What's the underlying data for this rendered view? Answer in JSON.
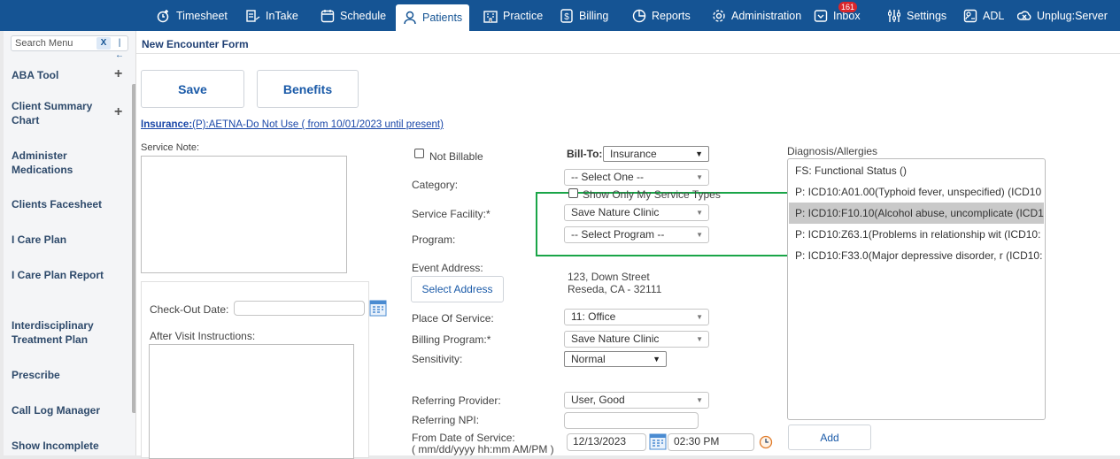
{
  "nav": {
    "items": [
      {
        "label": "Timesheet",
        "icon": "timesheet-icon"
      },
      {
        "label": "InTake",
        "icon": "intake-icon"
      },
      {
        "label": "Schedule",
        "icon": "calendar-icon"
      },
      {
        "label": "Patients",
        "icon": "person-icon"
      },
      {
        "label": "Practice",
        "icon": "building-icon"
      },
      {
        "label": "Billing",
        "icon": "dollar-icon"
      },
      {
        "label": "Reports",
        "icon": "pie-chart-icon"
      },
      {
        "label": "Administration",
        "icon": "gear-icon"
      },
      {
        "label": "Inbox",
        "icon": "inbox-icon",
        "badge": "161"
      },
      {
        "label": "Settings",
        "icon": "sliders-icon"
      },
      {
        "label": "ADL",
        "icon": "adl-icon"
      },
      {
        "label": "Unplug:Server",
        "icon": "unplug-icon"
      }
    ],
    "active": "Patients",
    "bg_color": "#155494"
  },
  "sidebar": {
    "search_placeholder": "Search Menu",
    "clear_label": "X",
    "collapse_label": "|←",
    "items": [
      {
        "label": "ABA Tool",
        "expandable": true
      },
      {
        "label": "Client Summary Chart",
        "expandable": true
      },
      {
        "label": "Administer Medications",
        "expandable": false
      },
      {
        "label": "Clients Facesheet",
        "expandable": false
      },
      {
        "label": "I Care Plan",
        "expandable": false
      },
      {
        "label": "I Care Plan Report",
        "expandable": false
      },
      {
        "label": "Interdisciplinary Treatment Plan",
        "expandable": false
      },
      {
        "label": "Prescribe",
        "expandable": false
      },
      {
        "label": "Call Log Manager",
        "expandable": false
      },
      {
        "label": "Show Incomplete",
        "expandable": false
      }
    ]
  },
  "form": {
    "title": "New Encounter Form",
    "save_label": "Save",
    "benefits_label": "Benefits",
    "insurance_prefix": "Insurance:",
    "insurance_text": "(P):AETNA-Do Not Use ( from 10/01/2023 until present)",
    "service_note_label": "Service Note:",
    "checkout_label": "Check-Out Date:",
    "checkout_value": "",
    "after_visit_label": "After Visit Instructions:",
    "not_billable_label": "Not Billable",
    "bill_to_label": "Bill-To:",
    "bill_to_value": "Insurance",
    "category_label": "Category:",
    "category_value": "-- Select One --",
    "show_only_label": "Show Only My Service Types",
    "service_facility_label": "Service Facility:*",
    "service_facility_value": "Save Nature Clinic",
    "program_label": "Program:",
    "program_value": "-- Select Program --",
    "event_address_label": "Event Address:",
    "select_address_label": "Select Address",
    "address_line1": "123, Down Street",
    "address_line2": "Reseda, CA - 32111",
    "place_of_service_label": "Place Of Service:",
    "place_of_service_value": "11: Office",
    "billing_program_label": "Billing Program:*",
    "billing_program_value": "Save Nature Clinic",
    "sensitivity_label": "Sensitivity:",
    "sensitivity_value": "Normal",
    "referring_provider_label": "Referring Provider:",
    "referring_provider_value": "User, Good",
    "referring_npi_label": "Referring NPI:",
    "referring_npi_value": "",
    "from_date_label": "From Date of Service:",
    "from_date_hint": "( mm/dd/yyyy hh:mm AM/PM )",
    "from_date_value": "12/13/2023",
    "from_time_value": "02:30 PM"
  },
  "diagnosis": {
    "label": "Diagnosis/Allergies",
    "items": [
      "FS: Functional Status ()",
      "P: ICD10:A01.00(Typhoid fever, unspecified) (ICD10",
      "P: ICD10:F10.10(Alcohol abuse, uncomplicate (ICD1",
      "P: ICD10:Z63.1(Problems in relationship wit (ICD10:",
      "P: ICD10:F33.0(Major depressive disorder, r (ICD10:"
    ],
    "selected_index": 2,
    "add_label": "Add"
  },
  "colors": {
    "highlight_box": "#1aa548",
    "link": "#1a47a8"
  }
}
